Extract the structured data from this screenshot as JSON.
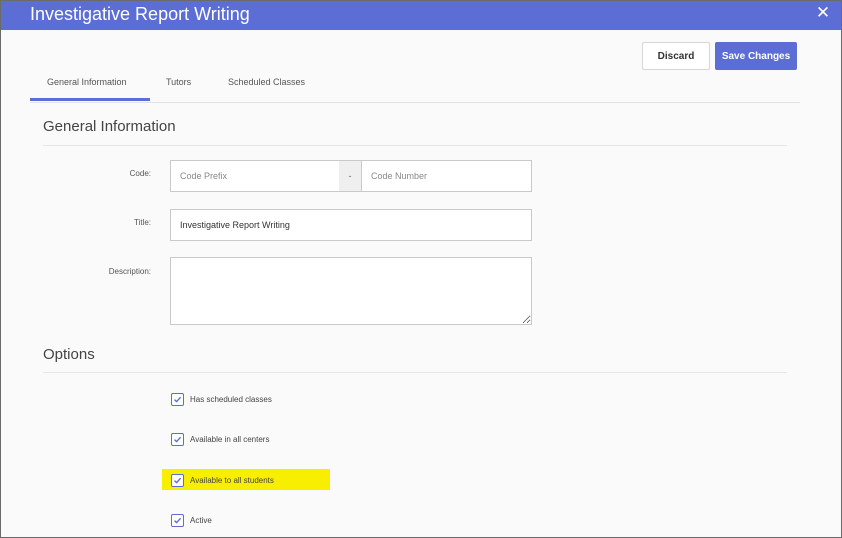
{
  "window": {
    "title": "Investigative Report Writing",
    "close_glyph": "✕"
  },
  "actions": {
    "discard_label": "Discard",
    "save_label": "Save Changes",
    "accent_color": "#5c6ed6"
  },
  "tabs": [
    {
      "label": "General Information",
      "active": true
    },
    {
      "label": "Tutors",
      "active": false
    },
    {
      "label": "Scheduled Classes",
      "active": false
    }
  ],
  "general": {
    "section_title": "General Information",
    "code": {
      "label": "Code:",
      "prefix_placeholder": "Code Prefix",
      "separator": "-",
      "number_placeholder": "Code Number"
    },
    "title_field": {
      "label": "Title:",
      "value": "Investigative Report Writing"
    },
    "description": {
      "label": "Description:",
      "value": ""
    }
  },
  "options": {
    "section_title": "Options",
    "items": [
      {
        "label": "Has scheduled classes",
        "checked": true
      },
      {
        "label": "Available in all centers",
        "checked": true
      },
      {
        "label": "Available to all students",
        "checked": true,
        "highlighted": true
      },
      {
        "label": "Active",
        "checked": true
      }
    ]
  }
}
